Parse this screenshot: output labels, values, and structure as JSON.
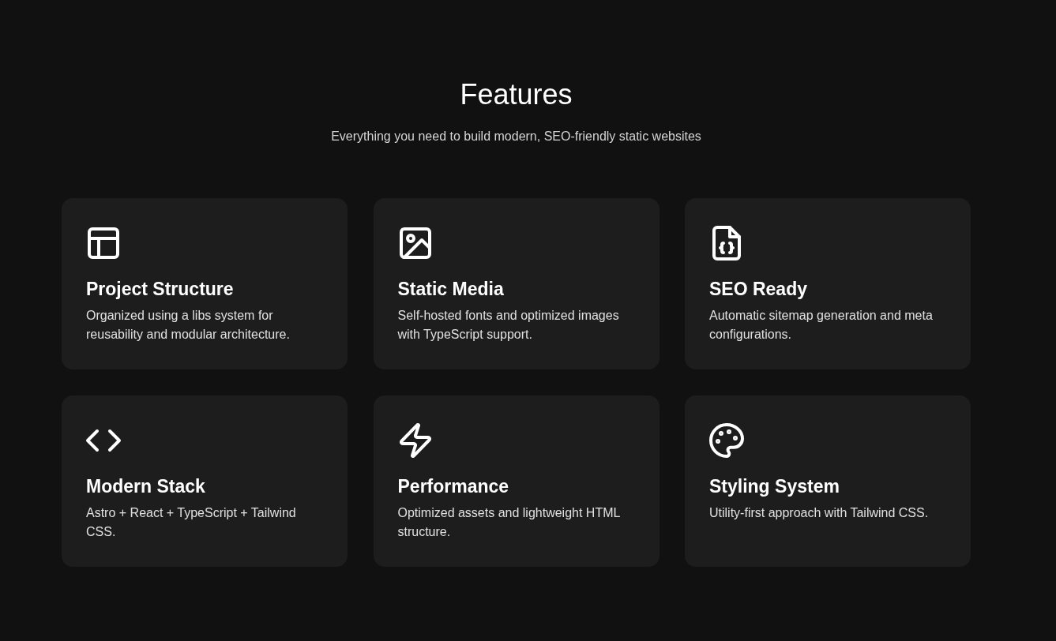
{
  "header": {
    "title": "Features",
    "subtitle": "Everything you need to build modern, SEO-friendly static websites"
  },
  "features": [
    {
      "kind": "layout",
      "title": "Project Structure",
      "description": "Organized using a libs system for reusability and modular architecture."
    },
    {
      "kind": "image",
      "title": "Static Media",
      "description": "Self-hosted fonts and optimized images with TypeScript support."
    },
    {
      "kind": "file-code",
      "title": "SEO Ready",
      "description": "Automatic sitemap generation and meta configurations."
    },
    {
      "kind": "code",
      "title": "Modern Stack",
      "description": "Astro + React + TypeScript + Tailwind CSS."
    },
    {
      "kind": "bolt",
      "title": "Performance",
      "description": "Optimized assets and lightweight HTML structure."
    },
    {
      "kind": "palette",
      "title": "Styling System",
      "description": "Utility-first approach with Tailwind CSS."
    }
  ]
}
